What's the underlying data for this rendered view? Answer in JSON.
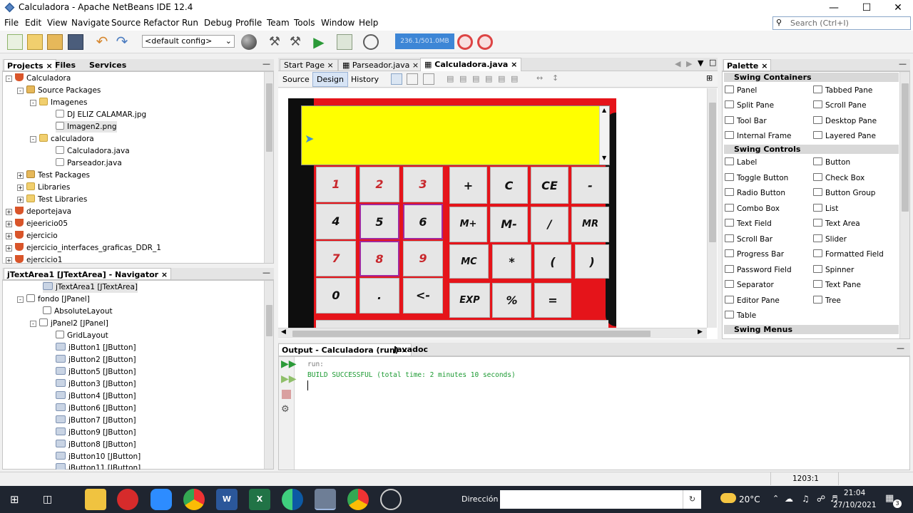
{
  "window": {
    "title": "Calculadora - Apache NetBeans IDE 12.4"
  },
  "menu": [
    "File",
    "Edit",
    "View",
    "Navigate",
    "Source",
    "Refactor",
    "Run",
    "Debug",
    "Profile",
    "Team",
    "Tools",
    "Window",
    "Help"
  ],
  "search": {
    "placeholder": "Search (Ctrl+I)"
  },
  "toolbar": {
    "config": "<default config>",
    "memory": "236.1/501.0MB"
  },
  "projects_panel": {
    "tabs": [
      "Projects",
      "Files",
      "Services"
    ],
    "nodes": [
      "Calculadora",
      "Source Packages",
      "Imagenes",
      "DJ ELIZ CALAMAR.jpg",
      "Imagen2.png",
      "calculadora",
      "Calculadora.java",
      "Parseador.java",
      "Test Packages",
      "Libraries",
      "Test Libraries",
      "deportejava",
      "ejeericio05",
      "ejercicio",
      "ejercicio_interfaces_graficas_DDR_1",
      "ejercicio1"
    ]
  },
  "navigator": {
    "title": "jTextArea1 [JTextArea] - Navigator",
    "nodes": [
      "jTextArea1 [JTextArea]",
      "fondo [JPanel]",
      "AbsoluteLayout",
      "jPanel2 [JPanel]",
      "GridLayout",
      "jButton1 [JButton]",
      "jButton2 [JButton]",
      "jButton5 [JButton]",
      "jButton3 [JButton]",
      "jButton4 [JButton]",
      "jButton6 [JButton]",
      "jButton7 [JButton]",
      "jButton9 [JButton]",
      "jButton8 [JButton]",
      "jButton10 [JButton]",
      "jButton11 [JButton]"
    ]
  },
  "editor": {
    "tabs": [
      "Start Page",
      "Parseador.java",
      "Calculadora.java"
    ],
    "subtabs": [
      "Source",
      "Design",
      "History"
    ]
  },
  "calculator": {
    "keys": [
      "1",
      "2",
      "3",
      "4",
      "5",
      "6",
      "7",
      "8",
      "9",
      "0",
      ".",
      "<-",
      "+",
      "C",
      "CE",
      "-",
      "M+",
      "M-",
      "/",
      "MR",
      "MC",
      "*",
      "(",
      ")",
      "EXP",
      "%",
      "="
    ]
  },
  "output": {
    "tabs": [
      "Output - Calculadora (run)",
      "Javadoc"
    ],
    "lines": [
      "run:",
      "BUILD SUCCESSFUL (total time: 2 minutes 10 seconds)"
    ]
  },
  "palette": {
    "title": "Palette",
    "containers_title": "Swing Containers",
    "containers": [
      "Panel",
      "Tabbed Pane",
      "Split Pane",
      "Scroll Pane",
      "Tool Bar",
      "Desktop Pane",
      "Internal Frame",
      "Layered Pane"
    ],
    "controls_title": "Swing Controls",
    "controls": [
      "Label",
      "Button",
      "Toggle Button",
      "Check Box",
      "Radio Button",
      "Button Group",
      "Combo Box",
      "List",
      "Text Field",
      "Text Area",
      "Scroll Bar",
      "Slider",
      "Progress Bar",
      "Formatted Field",
      "Password Field",
      "Spinner",
      "Separator",
      "Text Pane",
      "Editor Pane",
      "Tree",
      "Table"
    ],
    "menus_title": "Swing Menus"
  },
  "status": {
    "position": "1203:1"
  },
  "taskbar": {
    "address_label": "Dirección",
    "weather": "20°C",
    "time": "21:04",
    "date": "27/10/2021",
    "notifications": "3"
  },
  "colors": {
    "accent": "#3d86d6",
    "calc_bg": "#e5141a",
    "display": "#ffff00"
  }
}
